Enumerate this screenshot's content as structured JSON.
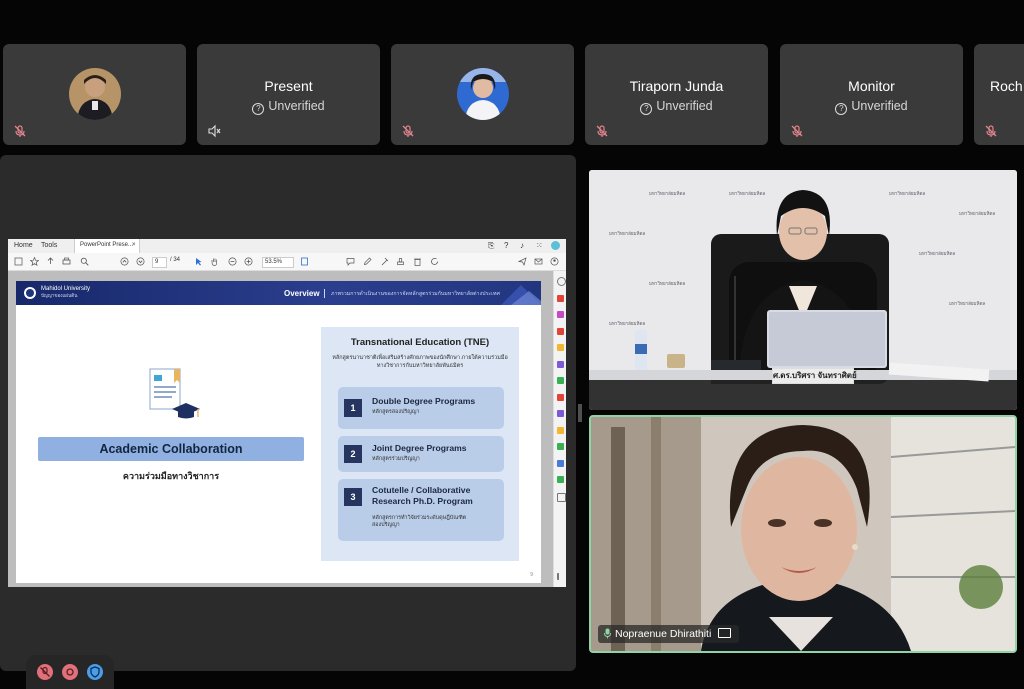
{
  "participants": [
    {
      "name": "",
      "status": "",
      "avatar": "woman-dark-top",
      "mic": "muted"
    },
    {
      "name": "Present",
      "status": "Unverified",
      "mic": "speaker-muted"
    },
    {
      "name": "",
      "status": "",
      "avatar": "woman-blue-bg",
      "mic": "muted"
    },
    {
      "name": "Tiraporn Junda",
      "status": "Unverified",
      "mic": "muted"
    },
    {
      "name": "Monitor",
      "status": "Unverified",
      "mic": "muted"
    },
    {
      "name": "Roch",
      "status": "",
      "mic": "muted"
    }
  ],
  "acrobat": {
    "menu": {
      "home": "Home",
      "tools": "Tools",
      "tab_label": "PowerPoint Prese..."
    },
    "page_current": "9",
    "page_total": "/ 34",
    "zoom": "53.5%"
  },
  "slide": {
    "org_name": "Mahidol University",
    "org_sub": "ปัญญาของแผ่นดิน",
    "section": "Overview",
    "section_sub": "ภาพรวมการดำเนินงานของการจัดหลักสูตรร่วมกับมหาวิทยาลัยต่างประเทศ",
    "left_title": "Academic Collaboration",
    "left_sub": "ความร่วมมือทางวิชาการ",
    "tne_title": "Transnational Education (TNE)",
    "tne_desc": "หลักสูตรนานาชาติเพื่อเสริมสร้างศักยภาพของนักศึกษา ภายใต้ความร่วมมือทางวิชาการกับมหาวิทยาลัยพันธมิตร",
    "programs": [
      {
        "num": "1",
        "title": "Double Degree Programs",
        "thai": "หลักสูตรสองปริญญา"
      },
      {
        "num": "2",
        "title": "Joint Degree Programs",
        "thai": "หลักสูตรร่วมปริญญา"
      },
      {
        "num": "3",
        "title": "Cotutelle / Collaborative\nResearch Ph.D. Program",
        "thai": "หลักสูตรการทำวิจัยร่วมระดับดุษฎีบัณฑิต\nสองปริญญา"
      }
    ],
    "page_no": "9"
  },
  "video_main": {
    "nameplate": "ศ.ดร.บริศรา จันทราศิตย์",
    "brand_text": "มหาวิทยาลัยมหิดล"
  },
  "video_speaker": {
    "name": "Nopraenue Dhirathiti"
  },
  "colors": {
    "accent_green": "#8fd3a7",
    "mute_red": "#e0707a",
    "shield_blue": "#4a9ee8",
    "tile_bg": "#3a3a3a"
  }
}
